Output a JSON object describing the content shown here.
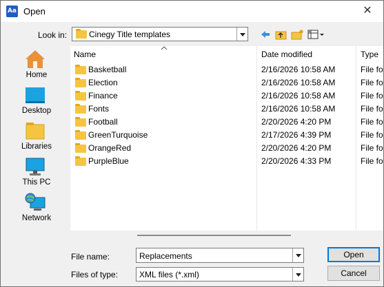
{
  "window": {
    "title": "Open",
    "app_icon_text": "Aa",
    "close_glyph": "✕"
  },
  "toolbar": {
    "look_in_label": "Look in:",
    "look_in_value": "Cinegy Title templates",
    "icons": [
      "back-arrow-icon",
      "up-folder-icon",
      "new-folder-icon",
      "view-menu-icon"
    ]
  },
  "places": [
    {
      "label": "Home",
      "icon": "home-icon"
    },
    {
      "label": "Desktop",
      "icon": "desktop-icon"
    },
    {
      "label": "Libraries",
      "icon": "libraries-icon"
    },
    {
      "label": "This PC",
      "icon": "this-pc-icon"
    },
    {
      "label": "Network",
      "icon": "network-icon"
    }
  ],
  "columns": {
    "name": "Name",
    "date": "Date modified",
    "type": "Type"
  },
  "files": [
    {
      "name": "Basketball",
      "date": "2/16/2026 10:58 AM",
      "type": "File fo"
    },
    {
      "name": "Election",
      "date": "2/16/2026 10:58 AM",
      "type": "File fo"
    },
    {
      "name": "Finance",
      "date": "2/16/2026 10:58 AM",
      "type": "File fo"
    },
    {
      "name": "Fonts",
      "date": "2/16/2026 10:58 AM",
      "type": "File fo"
    },
    {
      "name": "Football",
      "date": "2/20/2026 4:20 PM",
      "type": "File fo"
    },
    {
      "name": "GreenTurquoise",
      "date": "2/17/2026 4:39 PM",
      "type": "File fo"
    },
    {
      "name": "OrangeRed",
      "date": "2/20/2026 4:20 PM",
      "type": "File fo"
    },
    {
      "name": "PurpleBlue",
      "date": "2/20/2026 4:33 PM",
      "type": "File fo"
    }
  ],
  "form": {
    "file_name_label": "File name:",
    "file_name_value": "Replacements",
    "file_type_label": "Files of type:",
    "file_type_value": "XML files (*.xml)"
  },
  "buttons": {
    "open": "Open",
    "cancel": "Cancel"
  },
  "colors": {
    "accent": "#0078d7",
    "folder": "#f5c542"
  }
}
